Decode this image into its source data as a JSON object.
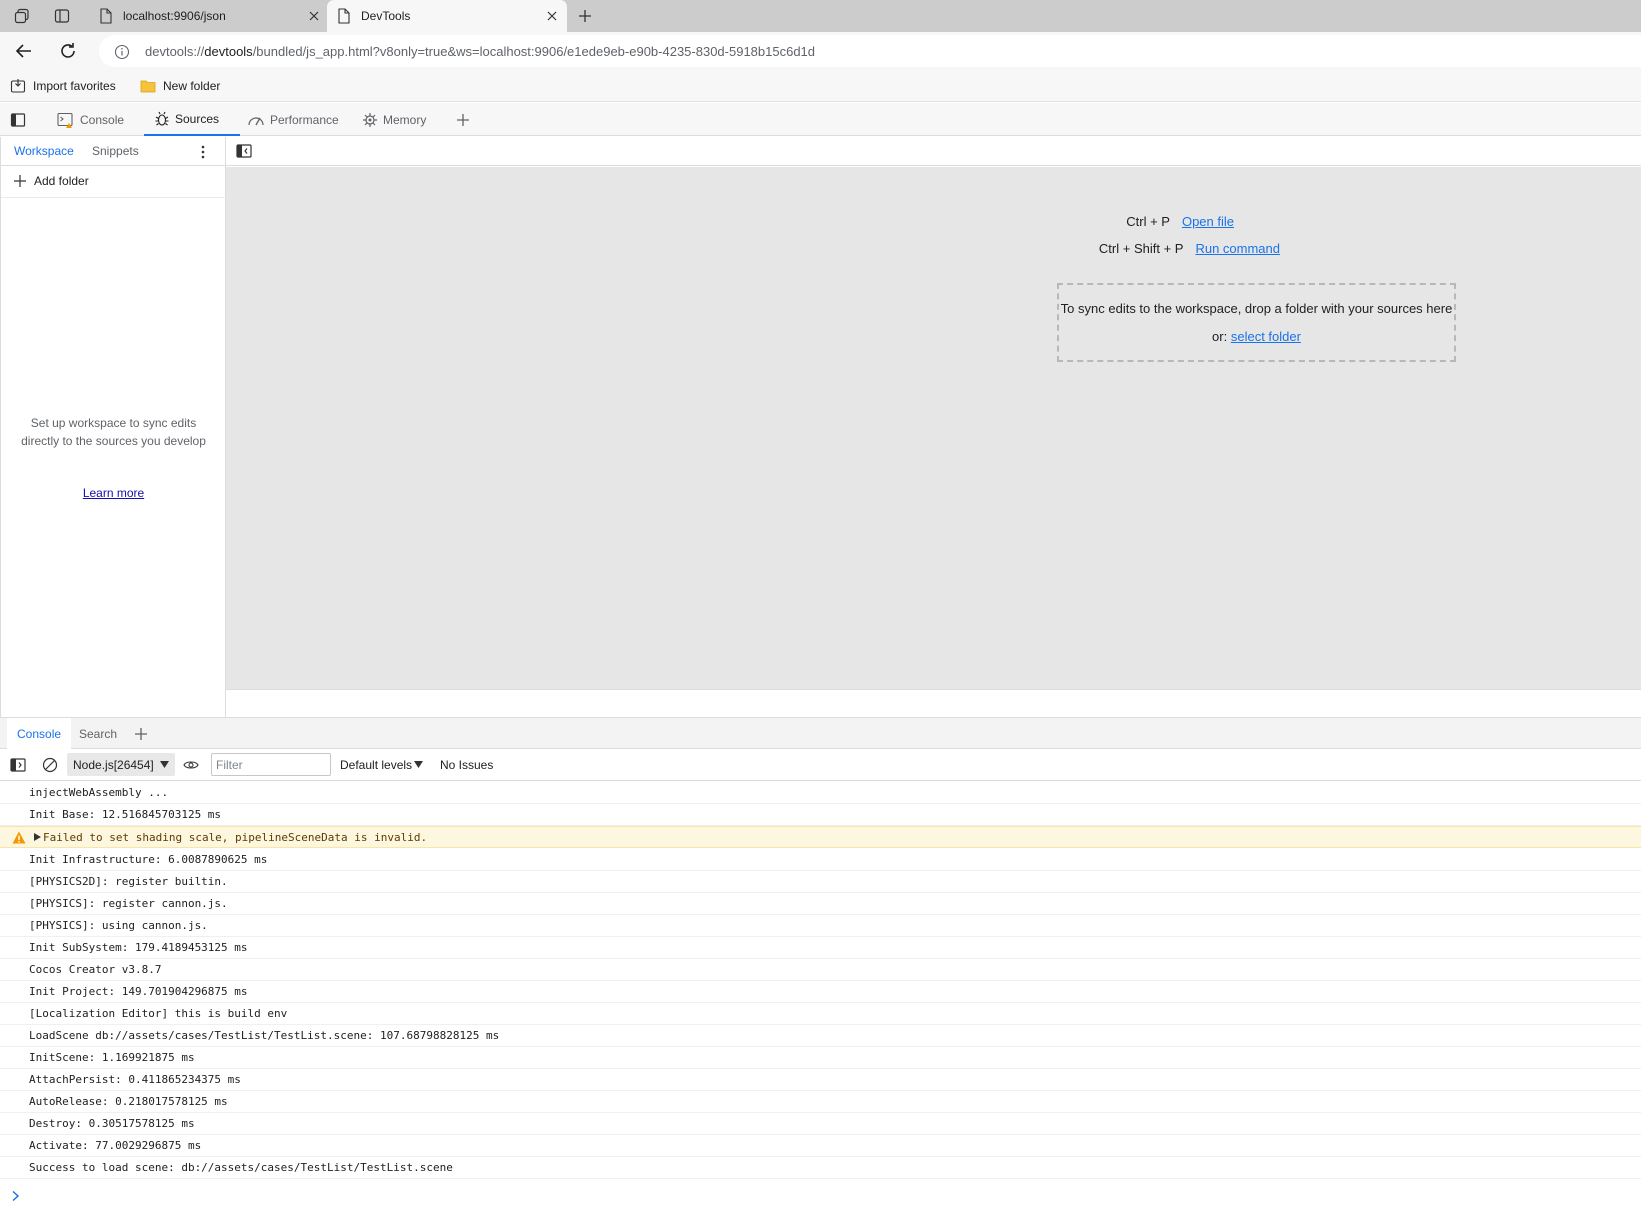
{
  "browser": {
    "tabs": [
      {
        "title": "localhost:9906/json",
        "active": false
      },
      {
        "title": "DevTools",
        "active": true
      }
    ],
    "address": {
      "scheme": "devtools://",
      "host": "devtools",
      "path": "/bundled/js_app.html?v8only=true&ws=localhost:9906/e1ede9eb-e90b-4235-830d-5918b15c6d1d"
    },
    "favorites": {
      "import_label": "Import favorites",
      "folder_label": "New folder"
    }
  },
  "devtools": {
    "tabs": {
      "console": "Console",
      "sources": "Sources",
      "performance": "Performance",
      "memory": "Memory"
    },
    "active_tab": "Sources",
    "colors": {
      "accent": "#1a73e8",
      "warning_bg": "#fef7e0",
      "warning_icon": "#f29900"
    }
  },
  "navigator": {
    "tabs": {
      "workspace": "Workspace",
      "snippets": "Snippets"
    },
    "add_folder": "Add folder",
    "help_text": "Set up workspace to sync edits directly to the sources you develop",
    "learn_more": "Learn more"
  },
  "editor": {
    "shortcuts": [
      {
        "keys": "Ctrl + P",
        "action": "Open file"
      },
      {
        "keys": "Ctrl + Shift + P",
        "action": "Run command"
      }
    ],
    "dropzone": {
      "text": "To sync edits to the workspace, drop a folder with your sources here or:",
      "link": "select folder"
    }
  },
  "drawer": {
    "tabs": {
      "console": "Console",
      "search": "Search"
    },
    "toolbar": {
      "context": "Node.js[26454]",
      "filter_placeholder": "Filter",
      "levels": "Default levels",
      "issues": "No Issues"
    }
  },
  "console_log": [
    {
      "level": "info",
      "text": "injectWebAssembly ..."
    },
    {
      "level": "info",
      "text": "Init Base: 12.516845703125 ms"
    },
    {
      "level": "warning",
      "text": "Failed to set shading scale, pipelineSceneData is invalid."
    },
    {
      "level": "info",
      "text": "Init Infrastructure: 6.0087890625 ms"
    },
    {
      "level": "info",
      "text": "[PHYSICS2D]: register builtin."
    },
    {
      "level": "info",
      "text": "[PHYSICS]: register cannon.js."
    },
    {
      "level": "info",
      "text": "[PHYSICS]: using cannon.js."
    },
    {
      "level": "info",
      "text": "Init SubSystem: 179.4189453125 ms"
    },
    {
      "level": "info",
      "text": "Cocos Creator v3.8.7"
    },
    {
      "level": "info",
      "text": "Init Project: 149.701904296875 ms"
    },
    {
      "level": "info",
      "text": "[Localization Editor] this is build env"
    },
    {
      "level": "info",
      "text": "LoadScene db://assets/cases/TestList/TestList.scene: 107.68798828125 ms"
    },
    {
      "level": "info",
      "text": "InitScene: 1.169921875 ms"
    },
    {
      "level": "info",
      "text": "AttachPersist: 0.411865234375 ms"
    },
    {
      "level": "info",
      "text": "AutoRelease: 0.218017578125 ms"
    },
    {
      "level": "info",
      "text": "Destroy: 0.30517578125 ms"
    },
    {
      "level": "info",
      "text": "Activate: 77.0029296875 ms"
    },
    {
      "level": "info",
      "text": "Success to load scene: db://assets/cases/TestList/TestList.scene"
    }
  ]
}
